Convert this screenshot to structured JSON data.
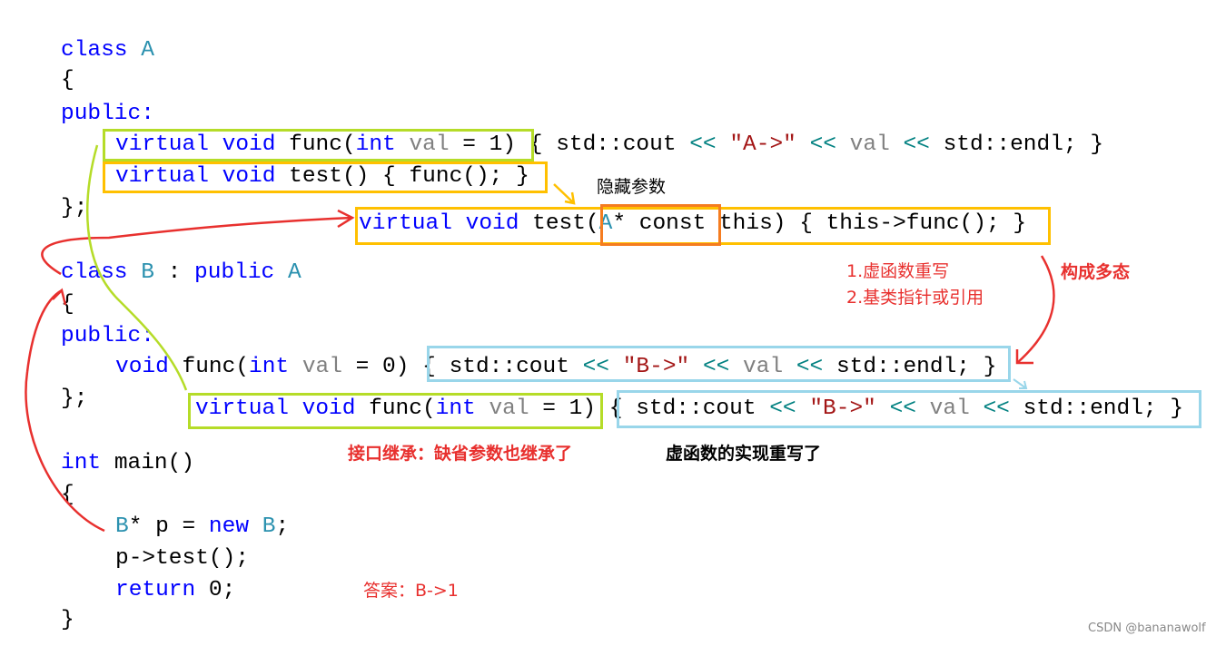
{
  "colors": {
    "keyword": "#0000ff",
    "class_name": "#2b91af",
    "param": "#808080",
    "string": "#a31515",
    "operator": "#008080",
    "annotation_red": "#e8302e",
    "box_green": "#b5dc28",
    "box_yellow": "#ffc000",
    "box_orange": "#f57c20",
    "box_cyan": "#99d6ea"
  },
  "code_lines": [
    [
      [
        "class ",
        "kw"
      ],
      [
        "A",
        "cls"
      ]
    ],
    [
      [
        "{",
        "pl"
      ]
    ],
    [
      [
        "public:",
        "kw"
      ]
    ],
    [
      [
        "virtual void ",
        "kw"
      ],
      [
        "func(",
        "pl"
      ],
      [
        "int ",
        "kw"
      ],
      [
        "val",
        "prm"
      ],
      [
        " = 1) { std::cout ",
        "pl"
      ],
      [
        "<< ",
        "op"
      ],
      [
        "\"A->\"",
        "str"
      ],
      [
        " ",
        "pl"
      ],
      [
        "<< ",
        "op"
      ],
      [
        "val",
        "prm"
      ],
      [
        " ",
        "pl"
      ],
      [
        "<<",
        "op"
      ],
      [
        " std::endl; }",
        "pl"
      ]
    ],
    [
      [
        "virtual void ",
        "kw"
      ],
      [
        "test() { func(); }",
        "pl"
      ]
    ],
    [
      [
        "};",
        "pl"
      ]
    ],
    [
      [
        "virtual void ",
        "kw"
      ],
      [
        "test(",
        "pl"
      ],
      [
        "A",
        "cls"
      ],
      [
        "* const this) { this->func(); }",
        "pl"
      ]
    ],
    [
      [
        "class ",
        "kw"
      ],
      [
        "B",
        "cls"
      ],
      [
        " : ",
        "pl"
      ],
      [
        "public ",
        "kw"
      ],
      [
        "A",
        "cls"
      ]
    ],
    [
      [
        "{",
        "pl"
      ]
    ],
    [
      [
        "public:",
        "kw"
      ]
    ],
    [
      [
        "void ",
        "kw"
      ],
      [
        "func(",
        "pl"
      ],
      [
        "int ",
        "kw"
      ],
      [
        "val",
        "prm"
      ],
      [
        " = 0) { std::cout ",
        "pl"
      ],
      [
        "<< ",
        "op"
      ],
      [
        "\"B->\"",
        "str"
      ],
      [
        " ",
        "pl"
      ],
      [
        "<< ",
        "op"
      ],
      [
        "val",
        "prm"
      ],
      [
        " ",
        "pl"
      ],
      [
        "<<",
        "op"
      ],
      [
        " std::endl; }",
        "pl"
      ]
    ],
    [
      [
        "};",
        "pl"
      ]
    ],
    [
      [
        "virtual void ",
        "kw"
      ],
      [
        "func(",
        "pl"
      ],
      [
        "int ",
        "kw"
      ],
      [
        "val",
        "prm"
      ],
      [
        " = 1) { std::cout ",
        "pl"
      ],
      [
        "<< ",
        "op"
      ],
      [
        "\"B->\"",
        "str"
      ],
      [
        " ",
        "pl"
      ],
      [
        "<< ",
        "op"
      ],
      [
        "val",
        "prm"
      ],
      [
        " ",
        "pl"
      ],
      [
        "<<",
        "op"
      ],
      [
        " std::endl; }",
        "pl"
      ]
    ],
    [
      [
        "int ",
        "kw"
      ],
      [
        "main()",
        "pl"
      ]
    ],
    [
      [
        "{",
        "pl"
      ]
    ],
    [
      [
        "B",
        "cls"
      ],
      [
        "* p = ",
        "pl"
      ],
      [
        "new ",
        "kw"
      ],
      [
        "B",
        "cls"
      ],
      [
        ";",
        "pl"
      ]
    ],
    [
      [
        "p->test();",
        "pl"
      ]
    ],
    [
      [
        "return ",
        "kw"
      ],
      [
        "0;",
        "pl"
      ]
    ],
    [
      [
        "}",
        "pl"
      ]
    ]
  ],
  "annotations": {
    "hidden_param": "隐藏参数",
    "cond1": "1.虚函数重写",
    "cond2": "2.基类指针或引用",
    "polymorphism": "构成多态",
    "interface_inherit": "接口继承：缺省参数也继承了",
    "impl_override": "虚函数的实现重写了",
    "answer": "答案：B->1"
  },
  "watermark": "CSDN @bananawolf"
}
